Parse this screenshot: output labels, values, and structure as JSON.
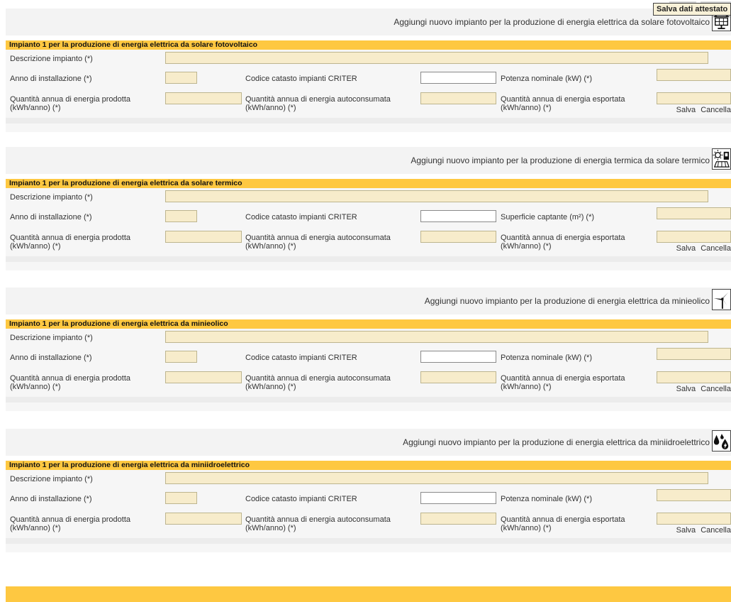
{
  "sections": [
    {
      "add_link": "Aggiungi nuovo impianto per la produzione di energia elettrica da solare fotovoltaico",
      "icon": "solar-panel-icon",
      "panel_title": "Impianto 1 per la produzione di energia elettrica da solare fotovoltaico",
      "desc_label": "Descrizione impianto (*)",
      "year_label": "Anno di installazione (*)",
      "criter_label": "Codice catasto impianti CRITER",
      "third_label": "Potenza nominale (kW) (*)",
      "prod_label": "Quantità annua di energia prodotta (kWh/anno) (*)",
      "self_label": "Quantità annua di energia autoconsumata (kWh/anno) (*)",
      "export_label": "Quantità annua di energia esportata (kWh/anno) (*)",
      "save": "Salva",
      "cancel": "Cancella"
    },
    {
      "add_link": "Aggiungi nuovo impianto per la produzione di energia termica da solare termico",
      "icon": "solar-thermal-icon",
      "panel_title": "Impianto 1 per la produzione di energia elettrica da solare termico",
      "desc_label": "Descrizione impianto (*)",
      "year_label": "Anno di installazione (*)",
      "criter_label": "Codice catasto impianti CRITER",
      "third_label": "Superficie captante (m²) (*)",
      "prod_label": "Quantità annua di energia prodotta (kWh/anno) (*)",
      "self_label": "Quantità annua di energia autoconsumata (kWh/anno) (*)",
      "export_label": "Quantità annua di energia esportata (kWh/anno) (*)",
      "save": "Salva",
      "cancel": "Cancella"
    },
    {
      "add_link": "Aggiungi nuovo impianto per la produzione di energia elettrica da minieolico",
      "icon": "wind-turbine-icon",
      "panel_title": "Impianto 1 per la produzione di energia elettrica da minieolico",
      "desc_label": "Descrizione impianto (*)",
      "year_label": "Anno di installazione (*)",
      "criter_label": "Codice catasto impianti CRITER",
      "third_label": "Potenza nominale (kW) (*)",
      "prod_label": "Quantità annua di energia prodotta (kWh/anno) (*)",
      "self_label": "Quantità annua di energia autoconsumata (kWh/anno) (*)",
      "export_label": "Quantità annua di energia esportata (kWh/anno) (*)",
      "save": "Salva",
      "cancel": "Cancella"
    },
    {
      "add_link": "Aggiungi nuovo impianto per la produzione di energia elettrica da miniidroelettrico",
      "icon": "water-drops-icon",
      "panel_title": "Impianto 1 per la produzione di energia elettrica da miniidroelettrico",
      "desc_label": "Descrizione impianto (*)",
      "year_label": "Anno di installazione (*)",
      "criter_label": "Codice catasto impianti CRITER",
      "third_label": "Potenza nominale (kW) (*)",
      "prod_label": "Quantità annua di energia prodotta (kWh/anno) (*)",
      "self_label": "Quantità annua di energia autoconsumata (kWh/anno) (*)",
      "export_label": "Quantità annua di energia esportata (kWh/anno) (*)",
      "save": "Salva",
      "cancel": "Cancella"
    }
  ],
  "footer": {
    "save_button": "Salva dati attestato"
  },
  "colors": {
    "header_yellow": "#fec841",
    "field_fill": "#f7eccb",
    "panel_bg": "#f6f6f6",
    "bar_bg": "#f3f3f3"
  }
}
